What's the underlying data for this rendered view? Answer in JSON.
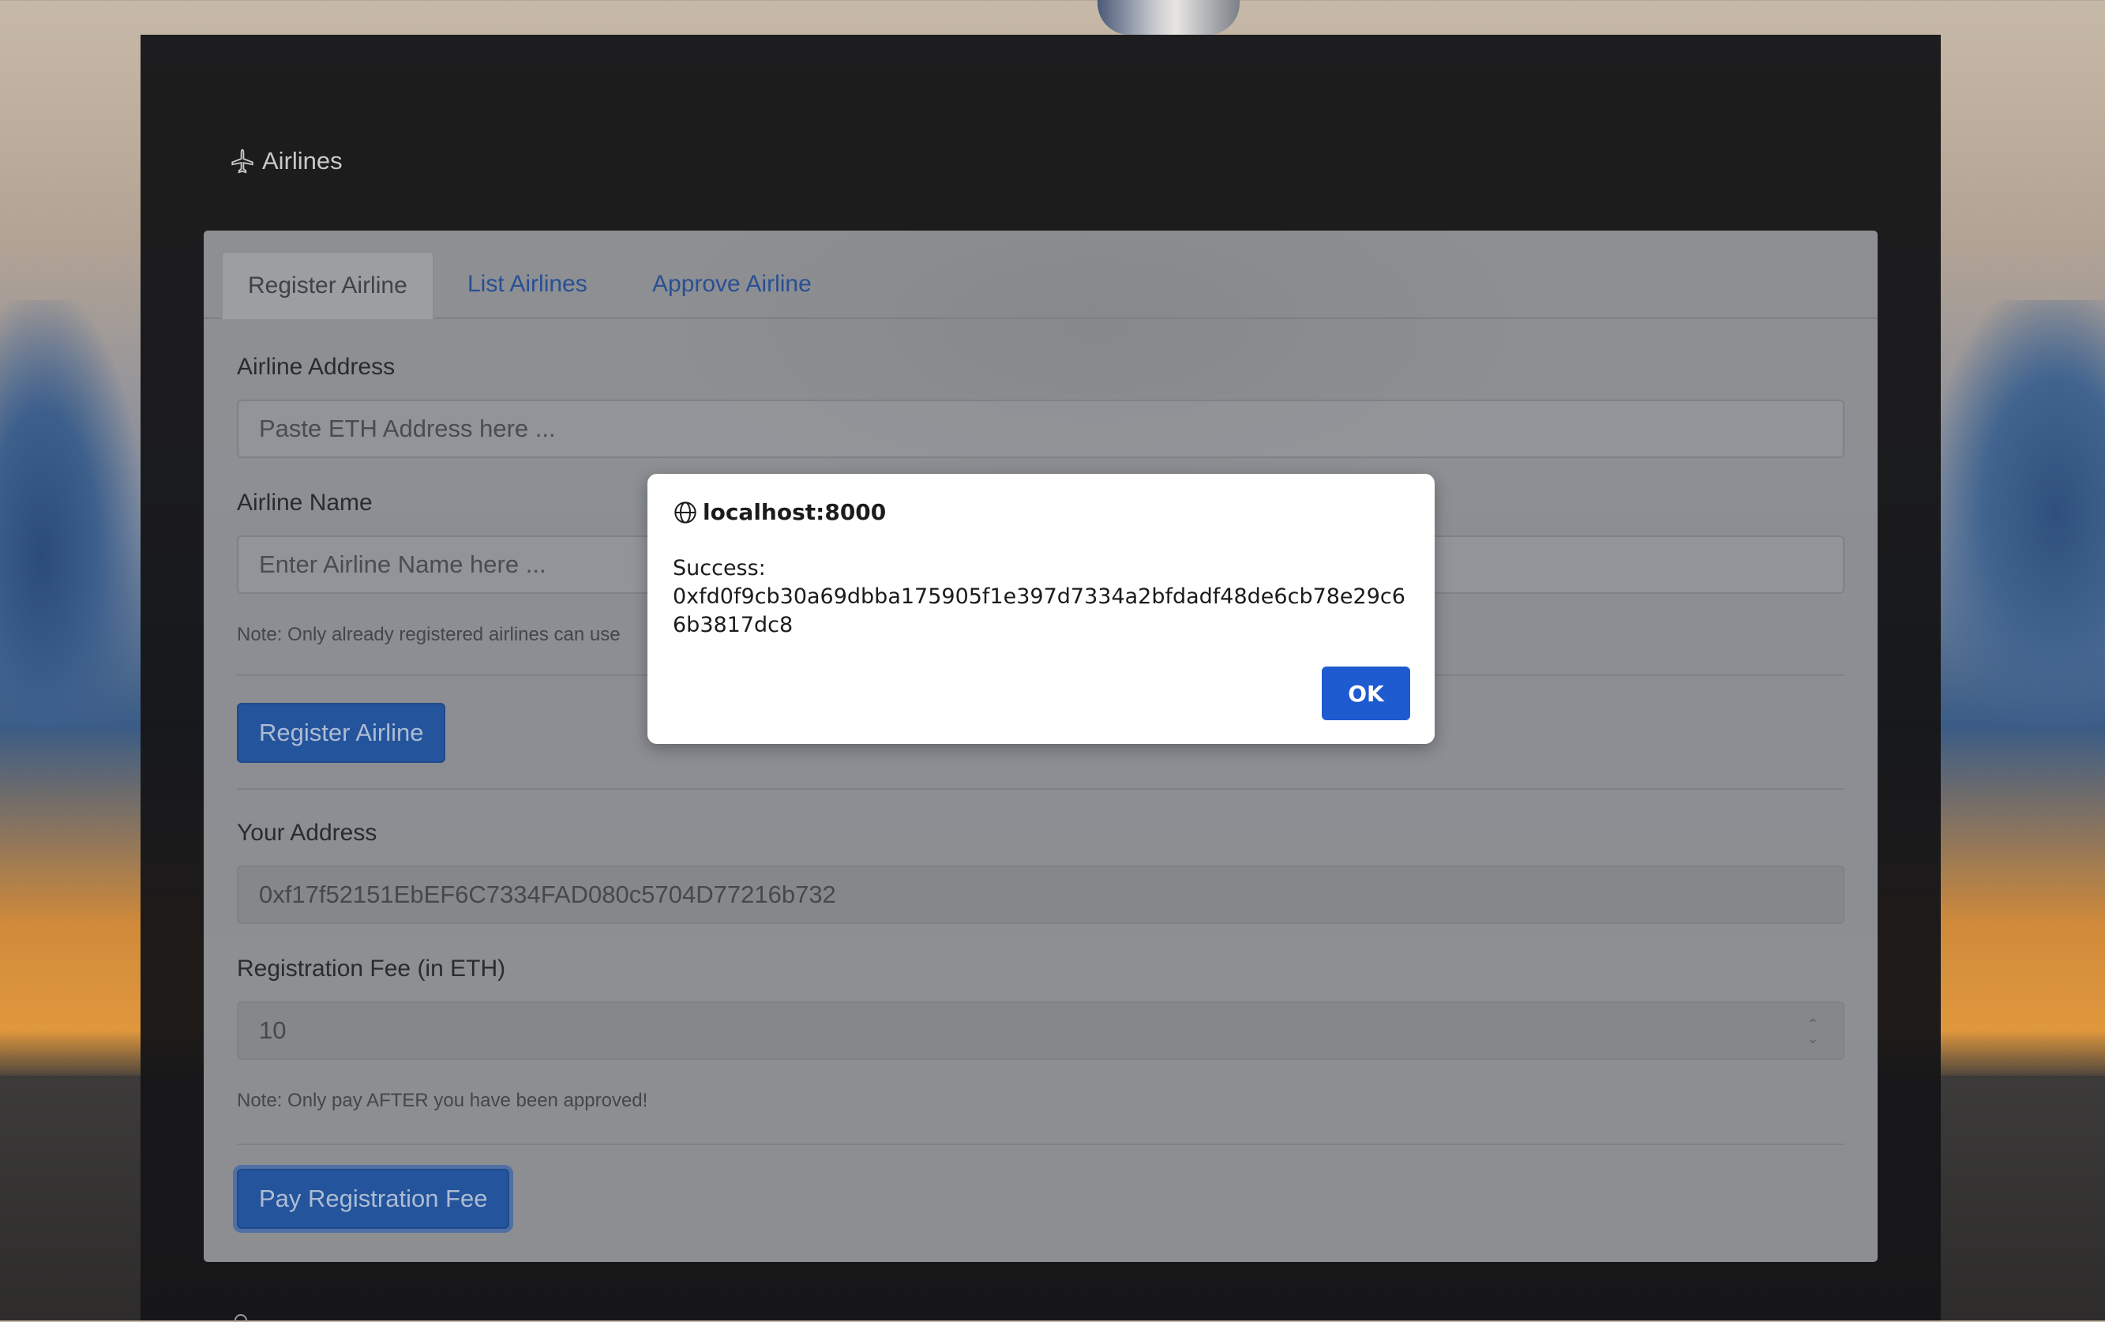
{
  "header": {
    "brand_icon": "airplane-icon",
    "brand_label": "Airlines"
  },
  "tabs": [
    {
      "label": "Register Airline",
      "active": true
    },
    {
      "label": "List Airlines",
      "active": false
    },
    {
      "label": "Approve Airline",
      "active": false
    }
  ],
  "register_form": {
    "airline_address_label": "Airline Address",
    "airline_address_placeholder": "Paste ETH Address here ...",
    "airline_address_value": "",
    "airline_name_label": "Airline Name",
    "airline_name_placeholder": "Enter Airline Name here ...",
    "airline_name_value": "",
    "note": "Note: Only already registered airlines can use",
    "register_button": "Register Airline"
  },
  "fee_form": {
    "your_address_label": "Your Address",
    "your_address_value": "0xf17f52151EbEF6C7334FAD080c5704D77216b732",
    "fee_label": "Registration Fee (in ETH)",
    "fee_value": "10",
    "note": "Note: Only pay AFTER you have been approved!",
    "pay_button": "Pay Registration Fee"
  },
  "dialog": {
    "icon": "globe-icon",
    "origin": "localhost:8000",
    "message_line1": "Success:",
    "message_line2": "0xfd0f9cb30a69dbba175905f1e397d7334a2bfdadf48de6cb78e29c66b3817dc8",
    "ok_button": "OK",
    "accent_color": "#1f5bd0"
  }
}
